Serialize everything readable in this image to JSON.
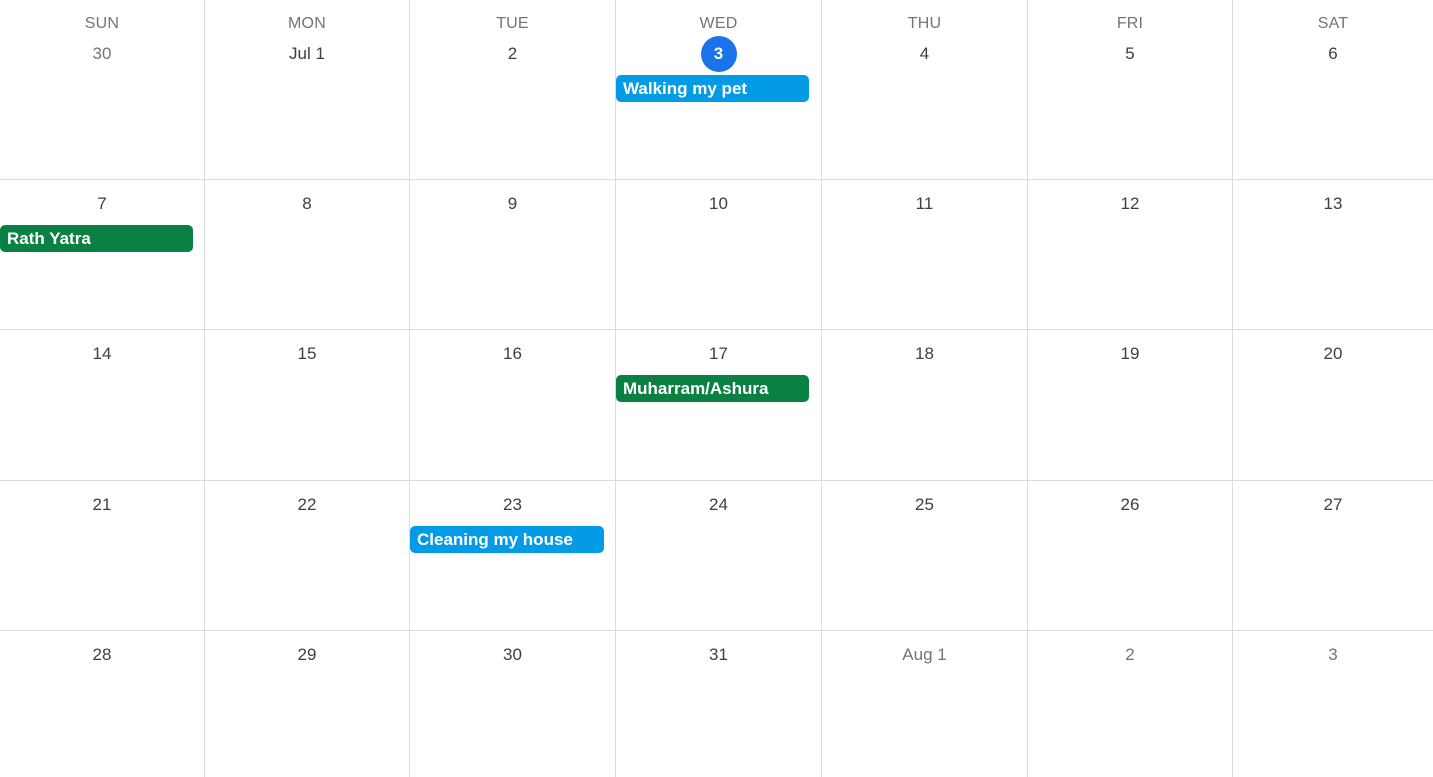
{
  "colors": {
    "today": "#1a73e8",
    "event_blue": "#039be5",
    "event_green": "#0b8043",
    "gridline": "#dadce0"
  },
  "weekdays": [
    "SUN",
    "MON",
    "TUE",
    "WED",
    "THU",
    "FRI",
    "SAT"
  ],
  "weeks": [
    [
      "30",
      "Jul 1",
      "2",
      "3",
      "4",
      "5",
      "6"
    ],
    [
      "7",
      "8",
      "9",
      "10",
      "11",
      "12",
      "13"
    ],
    [
      "14",
      "15",
      "16",
      "17",
      "18",
      "19",
      "20"
    ],
    [
      "21",
      "22",
      "23",
      "24",
      "25",
      "26",
      "27"
    ],
    [
      "28",
      "29",
      "30",
      "31",
      "Aug 1",
      "2",
      "3"
    ]
  ],
  "events": {
    "walking_pet": "Walking my pet",
    "rath_yatra": "Rath Yatra",
    "muharram": "Muharram/Ashura",
    "cleaning_house": "Cleaning my house"
  }
}
